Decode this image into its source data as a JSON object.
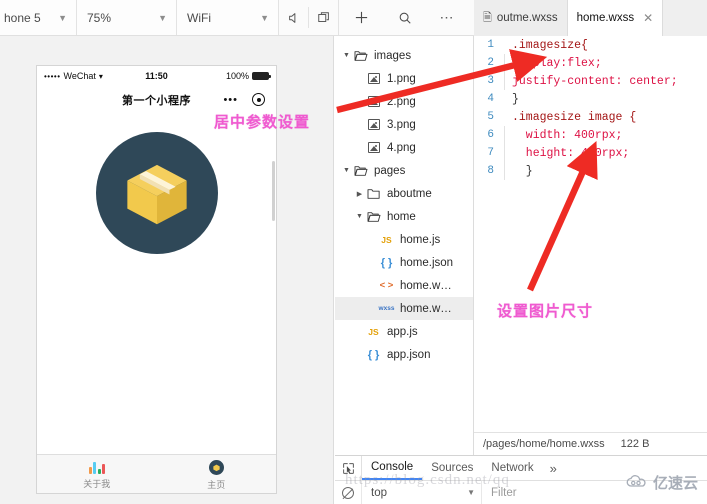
{
  "toolbar": {
    "device": "hone 5",
    "zoom": "75%",
    "network": "WiFi",
    "mute_icon": "speaker-mute-icon",
    "windows_icon": "windows-icon",
    "add_icon": "plus-icon",
    "search_icon": "search-icon",
    "more_icon": "more-horizontal-icon"
  },
  "editor_tabs": [
    {
      "label": "outme.wxss",
      "active": false,
      "closable": false
    },
    {
      "label": "home.wxss",
      "active": true,
      "closable": true,
      "close": "✕"
    }
  ],
  "simulator": {
    "status_bar": {
      "signal_dots": "•••••",
      "carrier": "WeChat",
      "wifi": "▼",
      "time": "11:50",
      "battery_percent": "100%"
    },
    "nav_title": "第一个小程序",
    "capsule_dots": "•••",
    "image": {
      "name": "package-box-image",
      "circle_color": "#2f4858",
      "box_color": "#f0c040"
    },
    "tabbar": [
      {
        "label": "关于我",
        "icon": "bar-chart-icon",
        "active": false
      },
      {
        "label": "主页",
        "icon": "home-circle-icon",
        "active": true
      }
    ]
  },
  "tree": [
    {
      "label": "images",
      "indent": 0,
      "arrow": "▼",
      "icon": "folder-open-icon",
      "type": "folder",
      "active": false
    },
    {
      "label": "1.png",
      "indent": 1,
      "arrow": "",
      "icon": "image-file-icon",
      "type": "image",
      "active": false
    },
    {
      "label": "2.png",
      "indent": 1,
      "arrow": "",
      "icon": "image-file-icon",
      "type": "image",
      "active": false
    },
    {
      "label": "3.png",
      "indent": 1,
      "arrow": "",
      "icon": "image-file-icon",
      "type": "image",
      "active": false
    },
    {
      "label": "4.png",
      "indent": 1,
      "arrow": "",
      "icon": "image-file-icon",
      "type": "image",
      "active": false
    },
    {
      "label": "pages",
      "indent": 0,
      "arrow": "▼",
      "icon": "folder-open-icon",
      "type": "folder",
      "active": false
    },
    {
      "label": "aboutme",
      "indent": 1,
      "arrow": "▶",
      "icon": "folder-closed-icon",
      "type": "folder",
      "active": false
    },
    {
      "label": "home",
      "indent": 1,
      "arrow": "▼",
      "icon": "folder-open-icon",
      "type": "folder",
      "active": false
    },
    {
      "label": "home.js",
      "indent": 2,
      "arrow": "",
      "icon": "js-file-icon",
      "type": "js",
      "badge": "JS",
      "active": false
    },
    {
      "label": "home.json",
      "indent": 2,
      "arrow": "",
      "icon": "json-file-icon",
      "type": "json",
      "badge": "{ }",
      "active": false
    },
    {
      "label": "home.w…",
      "indent": 2,
      "arrow": "",
      "icon": "wxml-file-icon",
      "type": "wxml",
      "badge": "< >",
      "active": false
    },
    {
      "label": "home.w…",
      "indent": 2,
      "arrow": "",
      "icon": "wxss-file-icon",
      "type": "wxss",
      "badge": "wxss",
      "active": true
    },
    {
      "label": "app.js",
      "indent": 1,
      "arrow": "",
      "icon": "js-file-icon",
      "type": "js",
      "badge": "JS",
      "active": false
    },
    {
      "label": "app.json",
      "indent": 1,
      "arrow": "",
      "icon": "json-file-icon",
      "type": "json",
      "badge": "{ }",
      "active": false
    }
  ],
  "code": {
    "lines": [
      {
        "num": "1",
        "text": ".imagesize{",
        "kind": "sel",
        "guide": false
      },
      {
        "num": "2",
        "text": "display:flex;",
        "kind": "decl",
        "guide": true
      },
      {
        "num": "3",
        "text": "justify-content: center;",
        "kind": "decl",
        "guide": true
      },
      {
        "num": "4",
        "text": "}",
        "kind": "punc",
        "guide": false
      },
      {
        "num": "5",
        "text": ".imagesize image {",
        "kind": "sel",
        "guide": false
      },
      {
        "num": "6",
        "text": "  width: 400rpx;",
        "kind": "decl",
        "guide": true
      },
      {
        "num": "7",
        "text": "  height: 400rpx;",
        "kind": "decl",
        "guide": true
      },
      {
        "num": "8",
        "text": "  }",
        "kind": "punc",
        "guide": true
      }
    ]
  },
  "status_strip": {
    "path": "/pages/home/home.wxss",
    "size": "122 B"
  },
  "devtools": {
    "inspect_icon": "inspect-element-icon",
    "tabs": [
      {
        "label": "Console",
        "active": true
      },
      {
        "label": "Sources",
        "active": false
      },
      {
        "label": "Network",
        "active": false
      }
    ],
    "more": "»",
    "clear_icon": "clear-console-icon",
    "context": "top",
    "context_caret": "▼",
    "filter_placeholder": "Filter"
  },
  "annotations": [
    {
      "text": "居中参数设置",
      "color": "#f05ad0",
      "name": "annotation-center-params"
    },
    {
      "text": "设置图片尺寸",
      "color": "#f05ad0",
      "name": "annotation-image-size"
    }
  ],
  "watermark": {
    "url": "https://blog.csdn.net/qq",
    "brand": "亿速云"
  },
  "arrow_color": "#ee2b24"
}
